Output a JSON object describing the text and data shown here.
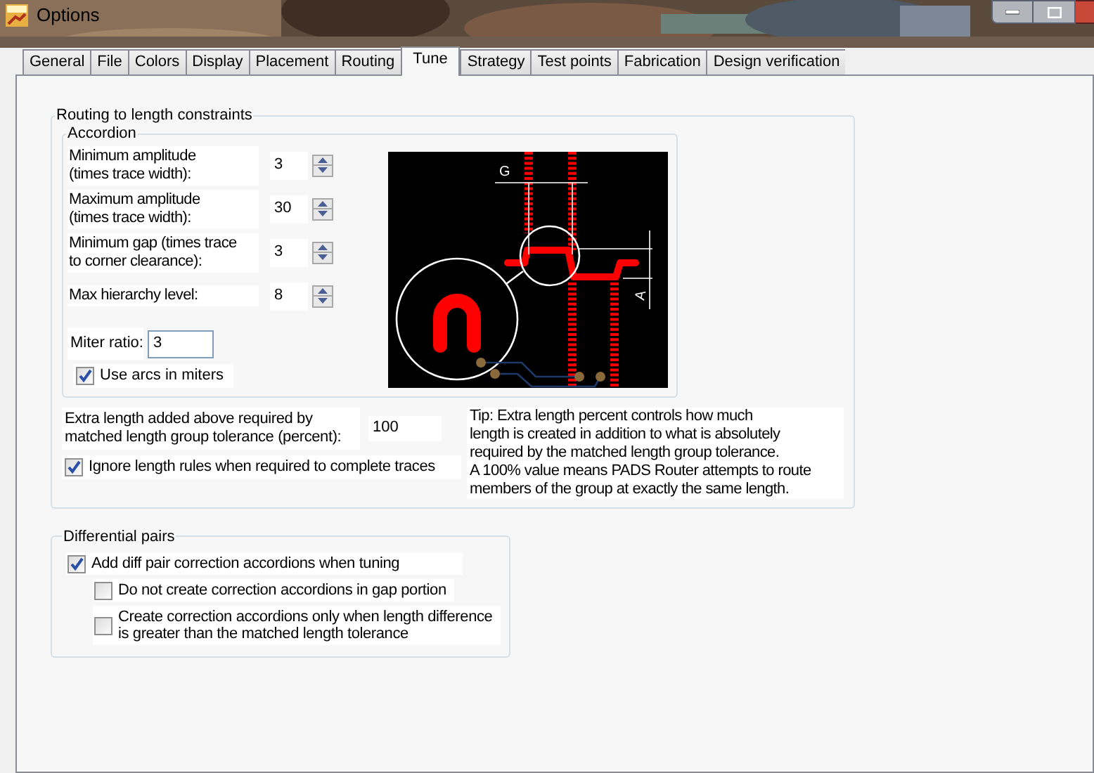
{
  "window": {
    "title": "Options"
  },
  "tabs": [
    {
      "label": "General",
      "selected": false
    },
    {
      "label": "File",
      "selected": false
    },
    {
      "label": "Colors",
      "selected": false
    },
    {
      "label": "Display",
      "selected": false
    },
    {
      "label": "Placement",
      "selected": false
    },
    {
      "label": "Routing",
      "selected": false
    },
    {
      "label": "Tune",
      "selected": true
    },
    {
      "label": "Strategy",
      "selected": false
    },
    {
      "label": "Test points",
      "selected": false
    },
    {
      "label": "Fabrication",
      "selected": false
    },
    {
      "label": "Design verification",
      "selected": false
    }
  ],
  "routing_group": {
    "title": "Routing to length constraints",
    "accordion": {
      "title": "Accordion",
      "spin_fields": [
        {
          "label": "Minimum amplitude\n(times trace width):",
          "value": "3"
        },
        {
          "label": "Maximum amplitude\n(times trace width):",
          "value": "30"
        },
        {
          "label": "Minimum gap (times trace\nto corner clearance):",
          "value": "3"
        },
        {
          "label": "Max hierarchy level:",
          "value": "8"
        }
      ],
      "miter_ratio": {
        "label": "Miter ratio:",
        "value": "3"
      },
      "use_arcs": {
        "label": "Use arcs in miters",
        "checked": true
      },
      "diagram_labels": [
        "G",
        "A"
      ]
    },
    "extra_length": {
      "label": "Extra length added above required by\nmatched length group tolerance (percent):",
      "value": "100"
    },
    "ignore_rules": {
      "label": "Ignore length rules when required to complete traces",
      "checked": true
    },
    "tip": "Tip: Extra length percent controls how much\nlength is created in addition to what is absolutely\nrequired by the matched length group tolerance.\nA 100% value means PADS Router attempts to route\nmembers of the group at exactly the same length."
  },
  "diff_pairs_group": {
    "title": "Differential pairs",
    "options": [
      {
        "label": "Add diff pair correction accordions when tuning",
        "checked": true,
        "children": [
          {
            "label": "Do not create correction accordions in gap portion",
            "checked": false
          },
          {
            "label": "Create correction accordions only when length difference\nis greater than the matched length tolerance",
            "checked": false
          }
        ]
      }
    ]
  }
}
